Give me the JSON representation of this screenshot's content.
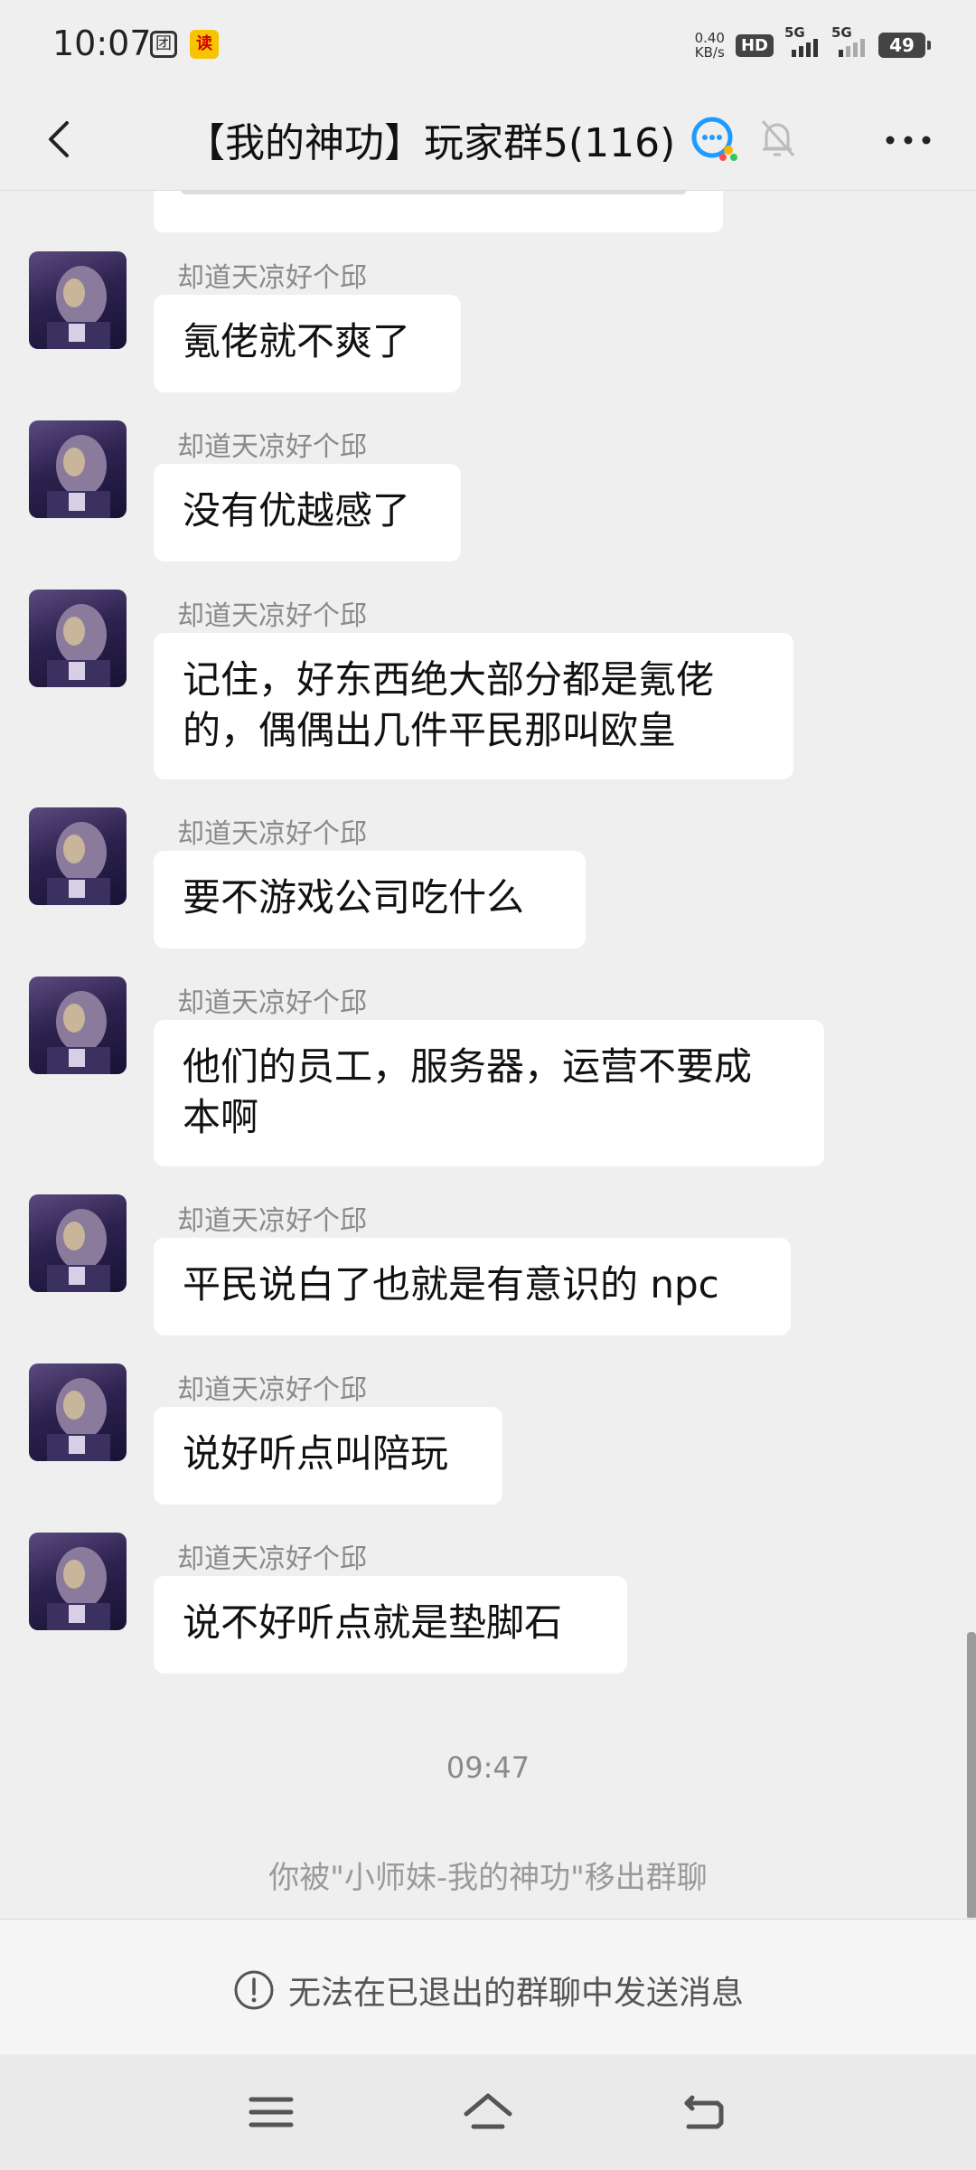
{
  "status_bar": {
    "time": "10:07",
    "app_icon_1": "团",
    "app_icon_2": "读",
    "net_speed_value": "0.40",
    "net_speed_unit": "KB/s",
    "hd_badge": "HD",
    "signal_1_label": "5G",
    "signal_2_label": "5G",
    "battery": "49"
  },
  "header": {
    "title": "【我的神功】玩家群5(116)",
    "icons": [
      "back-icon",
      "group-chat-bubble-icon",
      "bell-muted-icon",
      "more-icon"
    ]
  },
  "messages": [
    {
      "sender": "却道天凉好个邱",
      "text": [
        "氪佬就不爽了"
      ]
    },
    {
      "sender": "却道天凉好个邱",
      "text": [
        "没有优越感了"
      ]
    },
    {
      "sender": "却道天凉好个邱",
      "text": [
        "记住，好东西绝大部分都是氪佬",
        "的，偶偶出几件平民那叫欧皇"
      ]
    },
    {
      "sender": "却道天凉好个邱",
      "text": [
        "要不游戏公司吃什么"
      ]
    },
    {
      "sender": "却道天凉好个邱",
      "text": [
        "他们的员工，服务器，运营不要成",
        "本啊"
      ]
    },
    {
      "sender": "却道天凉好个邱",
      "text": [
        "平民说白了也就是有意识的 npc"
      ]
    },
    {
      "sender": "却道天凉好个邱",
      "text": [
        "说好听点叫陪玩"
      ]
    },
    {
      "sender": "却道天凉好个邱",
      "text": [
        "说不好听点就是垫脚石"
      ]
    }
  ],
  "timestamp": "09:47",
  "system_message": "你被\"小师妹-我的神功\"移出群聊",
  "notice": {
    "text": "无法在已退出的群聊中发送消息",
    "icon": "info-circle-icon"
  },
  "navbar": {
    "icons": [
      "menu-icon",
      "home-icon",
      "back-nav-icon"
    ]
  }
}
